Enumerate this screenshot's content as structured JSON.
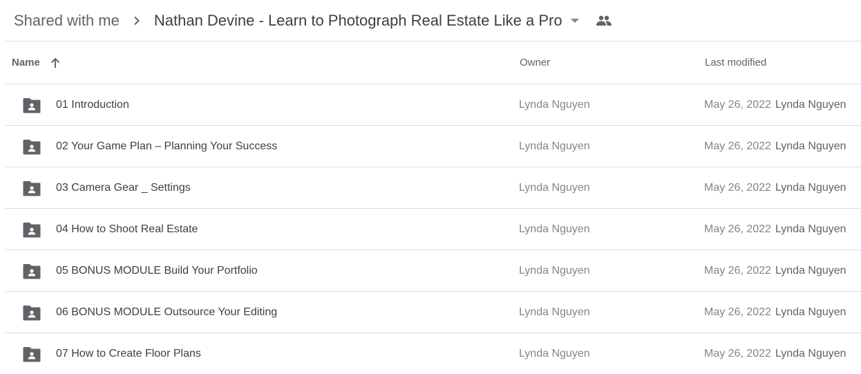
{
  "breadcrumb": {
    "root": "Shared with me",
    "separator_icon": "chevron-right-icon",
    "current": "Nathan Devine - Learn to Photograph Real Estate Like a Pro",
    "dropdown_icon": "caret-down-icon",
    "shared_icon": "people-icon"
  },
  "table": {
    "columns": {
      "name": "Name",
      "name_sort_icon": "arrow-up-icon",
      "owner": "Owner",
      "last_modified": "Last modified"
    },
    "rows": [
      {
        "icon": "shared-folder-icon",
        "name": "01 Introduction",
        "owner": "Lynda Nguyen",
        "modified_date": "May 26, 2022",
        "modified_by": "Lynda Nguyen"
      },
      {
        "icon": "shared-folder-icon",
        "name": "02 Your Game Plan – Planning Your Success",
        "owner": "Lynda Nguyen",
        "modified_date": "May 26, 2022",
        "modified_by": "Lynda Nguyen"
      },
      {
        "icon": "shared-folder-icon",
        "name": "03 Camera Gear _ Settings",
        "owner": "Lynda Nguyen",
        "modified_date": "May 26, 2022",
        "modified_by": "Lynda Nguyen"
      },
      {
        "icon": "shared-folder-icon",
        "name": "04 How to Shoot Real Estate",
        "owner": "Lynda Nguyen",
        "modified_date": "May 26, 2022",
        "modified_by": "Lynda Nguyen"
      },
      {
        "icon": "shared-folder-icon",
        "name": "05 BONUS MODULE Build Your Portfolio",
        "owner": "Lynda Nguyen",
        "modified_date": "May 26, 2022",
        "modified_by": "Lynda Nguyen"
      },
      {
        "icon": "shared-folder-icon",
        "name": "06 BONUS MODULE Outsource Your Editing",
        "owner": "Lynda Nguyen",
        "modified_date": "May 26, 2022",
        "modified_by": "Lynda Nguyen"
      },
      {
        "icon": "shared-folder-icon",
        "name": "07 How to Create Floor Plans",
        "owner": "Lynda Nguyen",
        "modified_date": "May 26, 2022",
        "modified_by": "Lynda Nguyen"
      }
    ]
  },
  "colors": {
    "icon_gray": "#5f6368",
    "divider": "#dadce0",
    "text_primary": "#3c4043",
    "text_secondary": "#80868b"
  }
}
